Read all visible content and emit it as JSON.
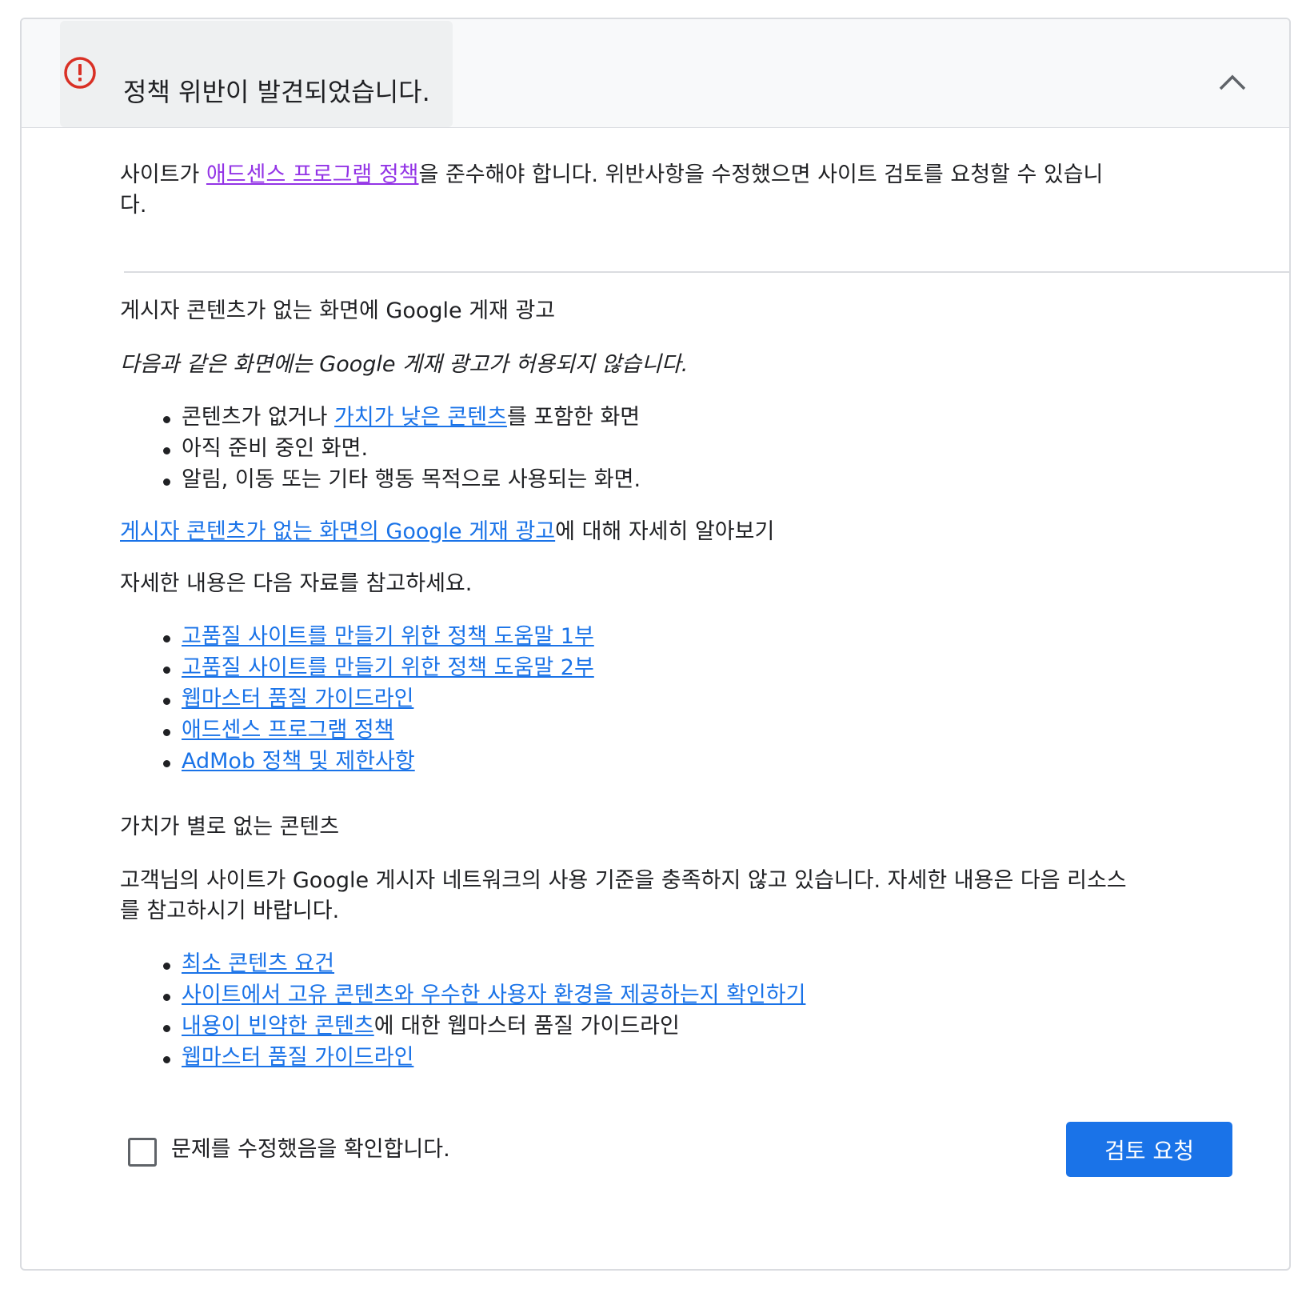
{
  "header": {
    "title": "정책 위반이 발견되었습니다."
  },
  "intro": {
    "text_before": "사이트가 ",
    "policy_link": "애드센스 프로그램 정책",
    "text_after_line1": "을 준수해야 합니다. 위반사항을 수정했으면 사이트 검토를 요청할 수 있습니",
    "text_line2": "다."
  },
  "section1": {
    "heading": "게시자 콘텐츠가 없는 화면에 Google 게재 광고",
    "subtitle": "다음과 같은 화면에는 Google 게재 광고가 허용되지 않습니다.",
    "bullet1_before": "콘텐츠가 없거나 ",
    "bullet1_link": "가치가 낮은 콘텐츠",
    "bullet1_after": "를 포함한 화면",
    "bullet2": "아직 준비 중인 화면.",
    "bullet3": "알림, 이동 또는 기타 행동 목적으로 사용되는 화면.",
    "learn_more_link": "게시자 콘텐츠가 없는 화면의 Google 게재 광고",
    "learn_more_after": "에 대해 자세히 알아보기",
    "refs_intro": "자세한 내용은 다음 자료를 참고하세요.",
    "refs": [
      "고품질 사이트를 만들기 위한 정책 도움말 1부",
      "고품질 사이트를 만들기 위한 정책 도움말 2부",
      "웹마스터 품질 가이드라인",
      "애드센스 프로그램 정책",
      "AdMob 정책 및 제한사항"
    ]
  },
  "section2": {
    "heading": "가치가 별로 없는 콘텐츠",
    "body_line1": "고객님의 사이트가 Google 게시자 네트워크의 사용 기준을 충족하지 않고 있습니다. 자세한 내용은 다음 리소스",
    "body_line2": "를 참고하시기 바랍니다.",
    "link1": "최소 콘텐츠 요건",
    "link2": "사이트에서 고유 콘텐츠와 우수한 사용자 환경을 제공하는지 확인하기",
    "link3": "내용이 빈약한 콘텐츠",
    "link3_after": "에 대한 웹마스터 품질 가이드라인",
    "link4": "웹마스터 품질 가이드라인"
  },
  "footer": {
    "checkbox_label": "문제를 수정했음을 확인합니다.",
    "checkbox_checked": false,
    "review_button": "검토 요청"
  },
  "colors": {
    "error_red": "#d93025",
    "link_blue": "#1a73e8",
    "visited_purple": "#9334e6",
    "button_blue": "#1a73e8"
  },
  "icons": {
    "error": "error-circle-icon",
    "collapse": "chevron-up-icon"
  }
}
